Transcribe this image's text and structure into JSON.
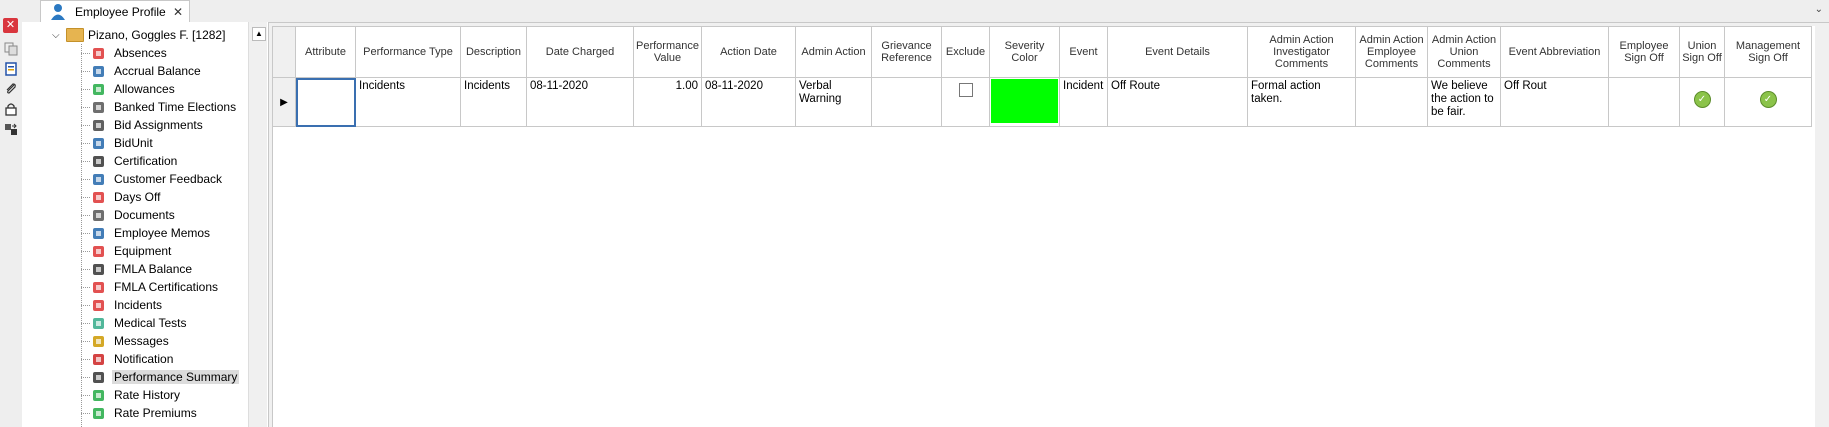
{
  "window": {
    "tab_title": "Employee Profile",
    "tab_close": "✕",
    "tab_menu": "⌄",
    "close_rail": "✕"
  },
  "tree": {
    "root_label": "Pizano, Goggles F. [1282]",
    "items": [
      {
        "label": "Absences",
        "icon": "absence-icon",
        "color": "#d33"
      },
      {
        "label": "Accrual Balance",
        "icon": "accrual-icon",
        "color": "#26a"
      },
      {
        "label": "Allowances",
        "icon": "allowance-icon",
        "color": "#2a4"
      },
      {
        "label": "Banked Time Elections",
        "icon": "bank-icon",
        "color": "#555"
      },
      {
        "label": "Bid Assignments",
        "icon": "bid-icon",
        "color": "#444"
      },
      {
        "label": "BidUnit",
        "icon": "bidunit-icon",
        "color": "#26a"
      },
      {
        "label": "Certification",
        "icon": "certification-icon",
        "color": "#333"
      },
      {
        "label": "Customer Feedback",
        "icon": "feedback-icon",
        "color": "#26a"
      },
      {
        "label": "Days Off",
        "icon": "daysoff-icon",
        "color": "#d33"
      },
      {
        "label": "Documents",
        "icon": "paperclip-icon",
        "color": "#555"
      },
      {
        "label": "Employee Memos",
        "icon": "memo-icon",
        "color": "#26a"
      },
      {
        "label": "Equipment",
        "icon": "equipment-icon",
        "color": "#d33"
      },
      {
        "label": "FMLA Balance",
        "icon": "fmla-balance-icon",
        "color": "#333"
      },
      {
        "label": "FMLA Certifications",
        "icon": "fmla-cert-icon",
        "color": "#d33"
      },
      {
        "label": "Incidents",
        "icon": "warning-icon",
        "color": "#d33"
      },
      {
        "label": "Medical Tests",
        "icon": "medical-icon",
        "color": "#3a8"
      },
      {
        "label": "Messages",
        "icon": "envelope-icon",
        "color": "#c90"
      },
      {
        "label": "Notification",
        "icon": "alert-icon",
        "color": "#c22"
      },
      {
        "label": "Performance Summary",
        "icon": "shield-icon",
        "color": "#333"
      },
      {
        "label": "Rate History",
        "icon": "rate-history-icon",
        "color": "#2a4"
      },
      {
        "label": "Rate Premiums",
        "icon": "rate-premium-icon",
        "color": "#2a4"
      }
    ],
    "selected_index": 18
  },
  "grid": {
    "columns": [
      "Attribute",
      "Performance Type",
      "Description",
      "Date Charged",
      "Performance Value",
      "Action Date",
      "Admin Action",
      "Grievance Reference",
      "Exclude",
      "Severity Color",
      "Event",
      "Event Details",
      "Admin Action Investigator Comments",
      "Admin Action Employee Comments",
      "Admin Action Union Comments",
      "Event Abbreviation",
      "Employee Sign Off",
      "Union Sign Off",
      "Management Sign Off"
    ],
    "row": {
      "attribute": "",
      "performance_type": "Incidents",
      "description": "Incidents",
      "date_charged": "08-11-2020",
      "performance_value": "1.00",
      "action_date": "08-11-2020",
      "admin_action": "Verbal Warning",
      "grievance_reference": "",
      "exclude": false,
      "severity_color": "#00ff00",
      "event": "Incident",
      "event_details": "Off Route",
      "investigator_comments": "Formal action taken.",
      "employee_comments": "",
      "union_comments": "We believe the action to be fair.",
      "event_abbreviation": "Off Rout",
      "employee_sign_off": "",
      "union_sign_off": true,
      "management_sign_off": true
    }
  }
}
